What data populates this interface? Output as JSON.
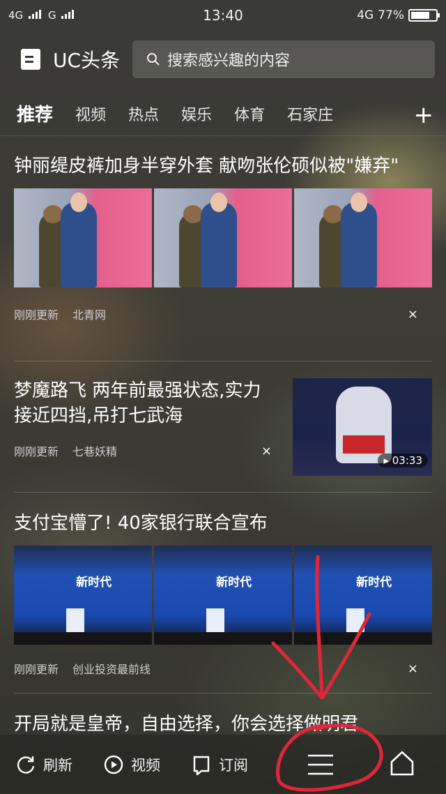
{
  "status_bar": {
    "network_1": "4G",
    "network_2": "G",
    "time": "13:40",
    "network_3": "4G",
    "battery": "77%",
    "battery_level": 0.77
  },
  "header": {
    "app_name": "UC头条",
    "search_placeholder": "搜索感兴趣的内容"
  },
  "tabs": [
    {
      "label": "推荐",
      "active": true
    },
    {
      "label": "视频"
    },
    {
      "label": "热点"
    },
    {
      "label": "娱乐"
    },
    {
      "label": "体育"
    },
    {
      "label": "石家庄"
    }
  ],
  "tab_add": "+",
  "articles": [
    {
      "title": "钟丽缇皮裤加身半穿外套 献吻张伦硕似被\"嫌弃\"",
      "time": "刚刚更新",
      "source": "北青网",
      "dismiss": "×"
    },
    {
      "title": "梦魔路飞 两年前最强状态,实力接近四挡,吊打七武海",
      "time": "刚刚更新",
      "source": "七巷妖精",
      "duration": "▸ 03:33",
      "dismiss": "×"
    },
    {
      "title": "支付宝懵了! 40家银行联合宣布",
      "time": "刚刚更新",
      "source": "创业投资最前线",
      "stage_text": "新时代",
      "dismiss": "×"
    },
    {
      "title": "开局就是皇帝，自由选择，你会选择做明君"
    }
  ],
  "bottom_bar": {
    "refresh": "刷新",
    "video": "视频",
    "subscribe": "订阅"
  },
  "colors": {
    "annotation": "#e0273a"
  }
}
